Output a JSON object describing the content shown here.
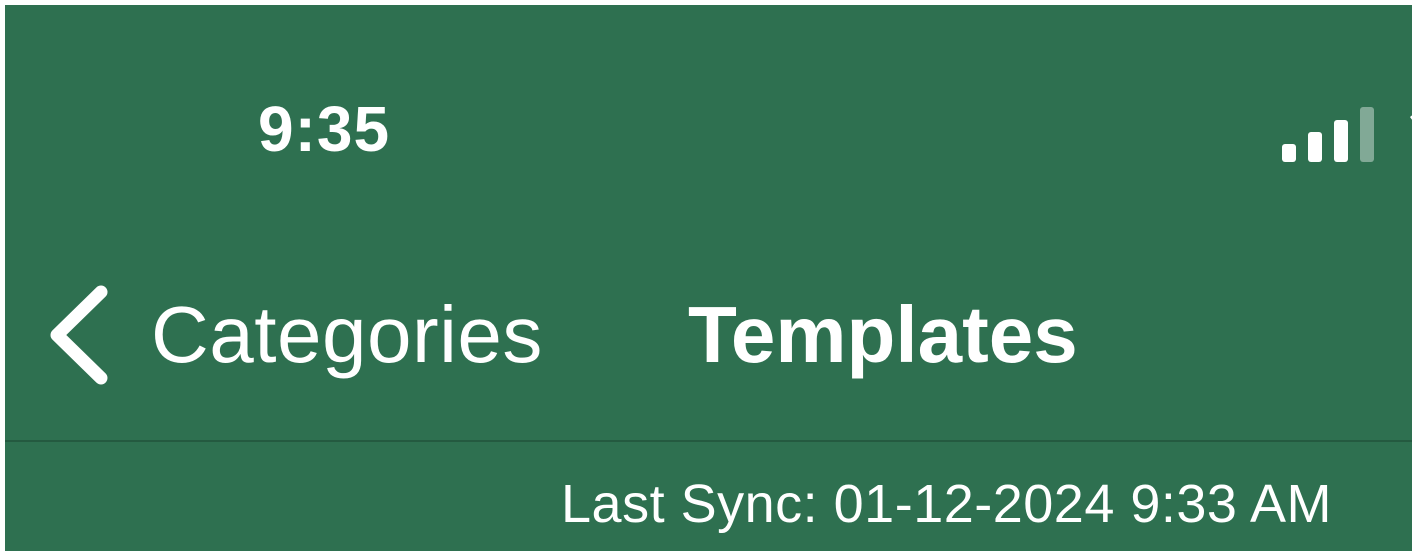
{
  "colors": {
    "header_background": "#2e7050",
    "foreground": "#ffffff"
  },
  "status_bar": {
    "time": "9:35",
    "signal_icon": "cellular-signal-icon",
    "signal_strength_bars": 3,
    "signal_total_bars": 4,
    "wifi_icon": "wifi-icon"
  },
  "navigation": {
    "back_icon": "chevron-left-icon",
    "back_label": "Categories",
    "title": "Templates"
  },
  "sync": {
    "text": "Last Sync: 01-12-2024 9:33 AM"
  }
}
